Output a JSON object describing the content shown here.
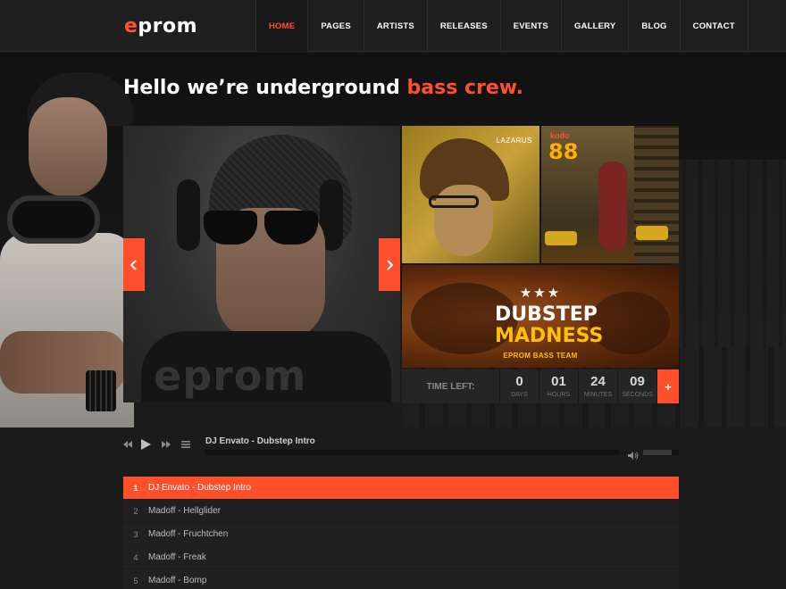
{
  "brand": {
    "logo_e": "e",
    "logo_rest": "prom",
    "accent": "#ff4f2b"
  },
  "nav": {
    "items": [
      {
        "label": "HOME",
        "active": true
      },
      {
        "label": "PAGES"
      },
      {
        "label": "ARTISTS"
      },
      {
        "label": "RELEASES"
      },
      {
        "label": "EVENTS"
      },
      {
        "label": "GALLERY"
      },
      {
        "label": "BLOG"
      },
      {
        "label": "CONTACT"
      }
    ]
  },
  "hero": {
    "headline_a": "Hello we’re underground ",
    "headline_b": "bass crew.",
    "slide_watermark": "eprom",
    "prev_icon": "chevron-left-icon",
    "next_icon": "chevron-right-icon"
  },
  "tiles": {
    "lazarus": "LAZARUS",
    "kodo_top": "kodo",
    "kodo_num": "88",
    "event_stars": "★★★",
    "event_line1": "DUBSTEP",
    "event_line2": "MADNESS",
    "event_line3": "EPROM BASS TEAM"
  },
  "countdown": {
    "label": "TIME LEFT:",
    "days": "0",
    "days_unit": "DAYS",
    "hours": "01",
    "hours_unit": "HOURS",
    "minutes": "24",
    "minutes_unit": "MINUTES",
    "seconds": "09",
    "seconds_unit": "SECONDS",
    "plus": "+"
  },
  "player": {
    "current_title": "DJ Envato - Dubstep Intro",
    "volume_level": 0.8,
    "tracks": [
      {
        "num": "1",
        "title": "DJ Envato - Dubstep Intro",
        "active": true
      },
      {
        "num": "2",
        "title": "Madoff - Hellglider"
      },
      {
        "num": "3",
        "title": "Madoff - Fruchtchen"
      },
      {
        "num": "4",
        "title": "Madoff - Freak"
      },
      {
        "num": "5",
        "title": "Madoff - Bomp"
      }
    ]
  }
}
